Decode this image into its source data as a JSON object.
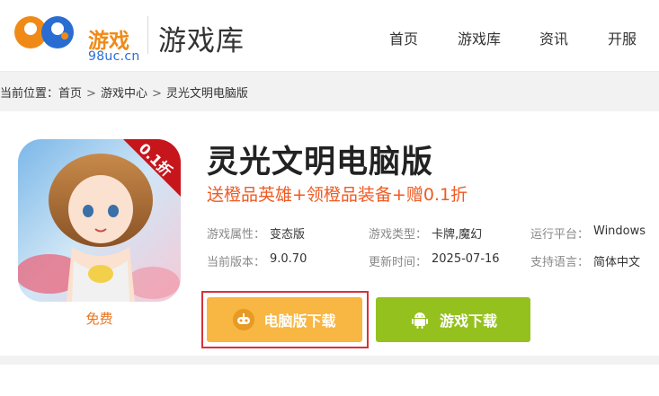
{
  "header": {
    "logo_number": "98",
    "logo_word": "游戏",
    "logo_domain": "98uc.cn",
    "title": "游戏库",
    "nav": [
      "首页",
      "游戏库",
      "资讯",
      "开服"
    ]
  },
  "breadcrumb": {
    "prefix": "当前位置：",
    "items": [
      "首页",
      "游戏中心",
      "灵光文明电脑版"
    ],
    "separator": ">"
  },
  "game": {
    "badge": "0.1折",
    "free_label": "免费",
    "title": "灵光文明电脑版",
    "promo": "送橙品英雄+领橙品装备+赠0.1折",
    "meta": {
      "attr_label": "游戏属性：",
      "attr_value": "变态版",
      "type_label": "游戏类型：",
      "type_value": "卡牌,魔幻",
      "platform_label": "运行平台：",
      "platform_value": "Windows",
      "version_label": "当前版本：",
      "version_value": "9.0.70",
      "update_label": "更新时间：",
      "update_value": "2025-07-16",
      "lang_label": "支持语言：",
      "lang_value": "简体中文"
    },
    "buttons": {
      "pc_download": "电脑版下载",
      "game_download": "游戏下载"
    }
  },
  "colors": {
    "brand_orange": "#f08a17",
    "brand_blue": "#2a6dd2",
    "promo_red": "#f05a22",
    "pc_button": "#f8b642",
    "android_button": "#95c11f",
    "highlight_outline": "#d8323a"
  },
  "icons": {
    "pc_button_icon": "gamepad-icon",
    "game_button_icon": "android-icon"
  }
}
